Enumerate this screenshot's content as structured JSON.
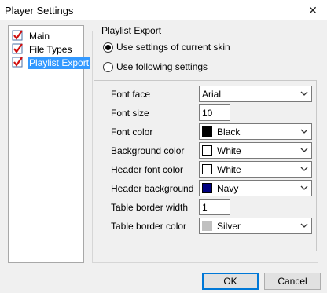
{
  "window": {
    "title": "Player Settings",
    "close_glyph": "✕"
  },
  "tree": {
    "items": [
      {
        "label": "Main",
        "icon": "checkmark-icon",
        "selected": false
      },
      {
        "label": "File Types",
        "icon": "checkmark-icon",
        "selected": false
      },
      {
        "label": "Playlist Export",
        "icon": "checkmark-icon",
        "selected": true
      }
    ]
  },
  "playlist_export": {
    "group_title": "Playlist Export",
    "radio_current_skin": "Use settings of current skin",
    "radio_following": "Use following settings",
    "selected_radio": "current_skin",
    "font_face_label": "Font face",
    "font_face_value": "Arial",
    "font_size_label": "Font size",
    "font_size_value": "10",
    "font_color_label": "Font color",
    "font_color_value": "Black",
    "font_color_hex": "#000000",
    "bg_color_label": "Background color",
    "bg_color_value": "White",
    "bg_color_hex": "#ffffff",
    "header_font_color_label": "Header font color",
    "header_font_color_value": "White",
    "header_font_color_hex": "#ffffff",
    "header_bg_label": "Header background",
    "header_bg_value": "Navy",
    "header_bg_hex": "#000080",
    "border_width_label": "Table border width",
    "border_width_value": "1",
    "border_color_label": "Table border color",
    "border_color_value": "Silver",
    "border_color_hex": "#c0c0c0"
  },
  "buttons": {
    "ok": "OK",
    "cancel": "Cancel"
  },
  "colors": {
    "selection": "#3399ff",
    "default_button_border": "#0078d7"
  }
}
